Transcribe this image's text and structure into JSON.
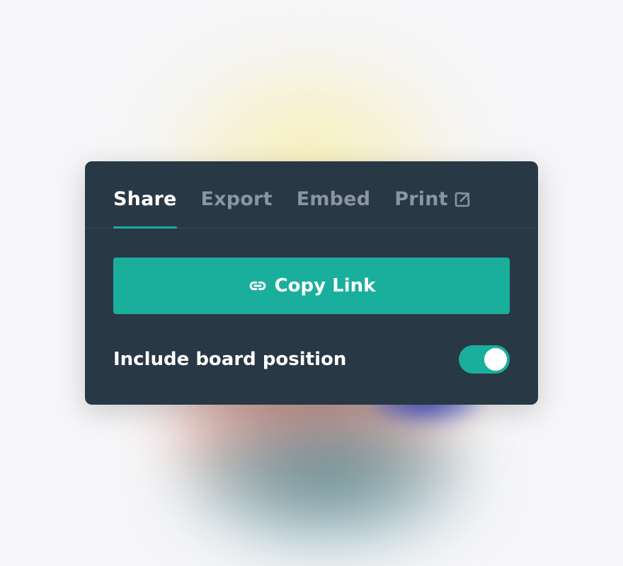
{
  "tabs": [
    {
      "label": "Share",
      "active": true
    },
    {
      "label": "Export",
      "active": false
    },
    {
      "label": "Embed",
      "active": false
    },
    {
      "label": "Print",
      "active": false,
      "icon": "external-link-icon"
    }
  ],
  "copy_button": {
    "label": "Copy Link",
    "icon": "link-icon"
  },
  "include_position": {
    "label": "Include board position",
    "enabled": true
  },
  "colors": {
    "panel_bg": "#283845",
    "accent": "#1aae9c",
    "tab_inactive": "#8a959e",
    "text": "#ffffff"
  }
}
